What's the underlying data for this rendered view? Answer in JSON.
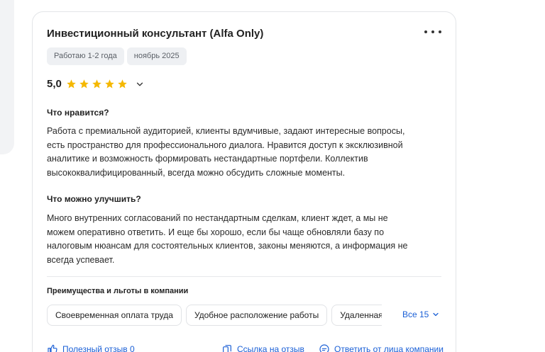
{
  "review": {
    "title": "Инвестиционный консультант (Alfa Only)",
    "tags": [
      "Работаю 1-2 года",
      "ноябрь 2025"
    ],
    "rating": {
      "value_label": "5,0",
      "stars": 5,
      "max": 5,
      "star_color": "#f5b800"
    },
    "likes": {
      "heading": "Что нравится?",
      "lines": [
        "Работа с премиальной аудиторией, клиенты вдумчивые, задают интересные вопросы,",
        "есть пространство для профессионального диалога. Нравится доступ к эксклюзивной",
        "аналитике и возможность формировать нестандартные портфели. Коллектив",
        "высококвалифицированный, всегда можно обсудить сложные моменты."
      ]
    },
    "improve": {
      "heading": "Что можно улучшить?",
      "lines": [
        "Много внутренних согласований по нестандартным сделкам, клиент ждет, а мы не",
        "можем оперативно ответить. И еще бы хорошо, если бы чаще обновляли базу по",
        "налоговым нюансам для состоятельных клиентов, законы меняются, а информация не",
        "всегда успевает."
      ]
    },
    "benefits": {
      "heading": "Преимущества и льготы в компании",
      "items": [
        "Своевременная оплата труда",
        "Удобное расположение работы",
        "Удаленная работа"
      ],
      "all_label": "Все 15"
    },
    "actions": {
      "helpful": "Полезный отзыв 0",
      "link": "Ссылка на отзыв",
      "reply": "Ответить от лица компании"
    }
  },
  "colors": {
    "accent": "#1a5fd6",
    "tag_bg": "#eef0f3",
    "star": "#f5b800"
  },
  "icons": [
    "more-vertical-dots-icon",
    "star-icon",
    "chevron-down-icon",
    "thumbs-up-icon",
    "link-icon",
    "chat-icon"
  ]
}
